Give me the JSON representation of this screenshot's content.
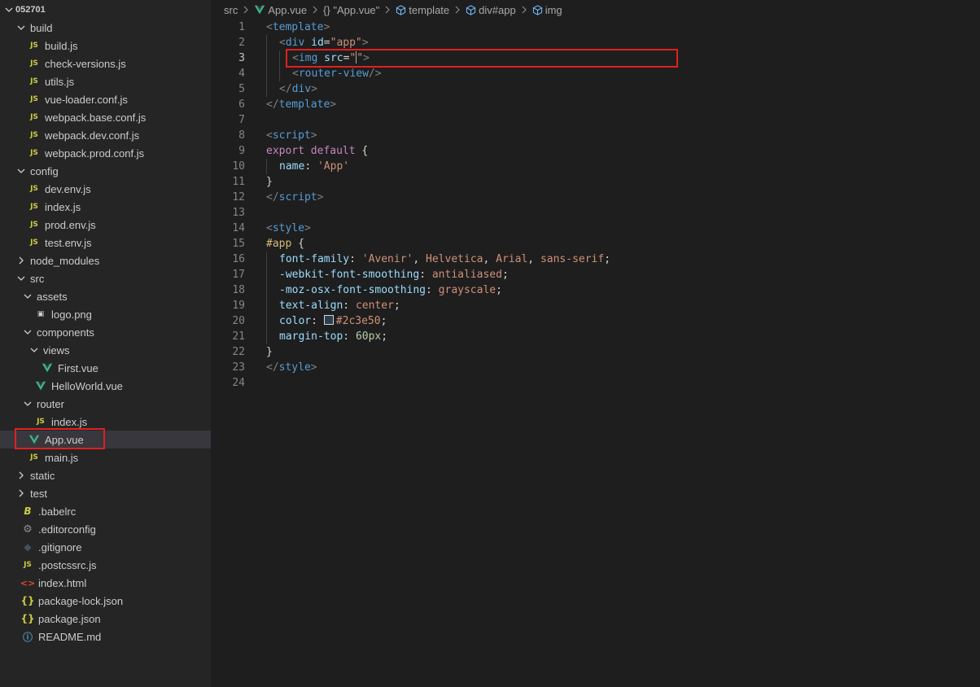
{
  "explorer": {
    "root": "052701",
    "items": [
      {
        "label": "build",
        "kind": "folder",
        "open": true,
        "depth": 1
      },
      {
        "label": "build.js",
        "kind": "js",
        "depth": 2
      },
      {
        "label": "check-versions.js",
        "kind": "js",
        "depth": 2
      },
      {
        "label": "utils.js",
        "kind": "js",
        "depth": 2
      },
      {
        "label": "vue-loader.conf.js",
        "kind": "js",
        "depth": 2
      },
      {
        "label": "webpack.base.conf.js",
        "kind": "js",
        "depth": 2
      },
      {
        "label": "webpack.dev.conf.js",
        "kind": "js",
        "depth": 2
      },
      {
        "label": "webpack.prod.conf.js",
        "kind": "js",
        "depth": 2
      },
      {
        "label": "config",
        "kind": "folder",
        "open": true,
        "depth": 1
      },
      {
        "label": "dev.env.js",
        "kind": "js",
        "depth": 2
      },
      {
        "label": "index.js",
        "kind": "js",
        "depth": 2
      },
      {
        "label": "prod.env.js",
        "kind": "js",
        "depth": 2
      },
      {
        "label": "test.env.js",
        "kind": "js",
        "depth": 2
      },
      {
        "label": "node_modules",
        "kind": "folder",
        "open": false,
        "depth": 1
      },
      {
        "label": "src",
        "kind": "folder",
        "open": true,
        "depth": 1
      },
      {
        "label": "assets",
        "kind": "folder",
        "open": true,
        "depth": 2
      },
      {
        "label": "logo.png",
        "kind": "png",
        "depth": 3
      },
      {
        "label": "components",
        "kind": "folder",
        "open": true,
        "depth": 2
      },
      {
        "label": "views",
        "kind": "folder",
        "open": true,
        "depth": 3
      },
      {
        "label": "First.vue",
        "kind": "vue",
        "depth": 4
      },
      {
        "label": "HelloWorld.vue",
        "kind": "vue",
        "depth": 3
      },
      {
        "label": "router",
        "kind": "folder",
        "open": true,
        "depth": 2
      },
      {
        "label": "index.js",
        "kind": "js",
        "depth": 3
      },
      {
        "label": "App.vue",
        "kind": "vue",
        "depth": 2,
        "selected": true
      },
      {
        "label": "main.js",
        "kind": "js",
        "depth": 2
      },
      {
        "label": "static",
        "kind": "folder",
        "open": false,
        "depth": 1
      },
      {
        "label": "test",
        "kind": "folder",
        "open": false,
        "depth": 1
      },
      {
        "label": ".babelrc",
        "kind": "babel",
        "depth": 1
      },
      {
        "label": ".editorconfig",
        "kind": "gear",
        "depth": 1
      },
      {
        "label": ".gitignore",
        "kind": "git",
        "depth": 1
      },
      {
        "label": ".postcssrc.js",
        "kind": "js",
        "depth": 1
      },
      {
        "label": "index.html",
        "kind": "html",
        "depth": 1
      },
      {
        "label": "package-lock.json",
        "kind": "json",
        "depth": 1
      },
      {
        "label": "package.json",
        "kind": "json",
        "depth": 1
      },
      {
        "label": "README.md",
        "kind": "info",
        "depth": 1
      }
    ]
  },
  "breadcrumb": [
    {
      "label": "src",
      "icon": ""
    },
    {
      "label": "App.vue",
      "icon": "vue-icon"
    },
    {
      "label": "{} \"App.vue\"",
      "icon": ""
    },
    {
      "label": "template",
      "icon": "cube-icon"
    },
    {
      "label": "div#app",
      "icon": "cube-icon"
    },
    {
      "label": "img",
      "icon": "cube-icon"
    }
  ],
  "editor": {
    "active_line": 3,
    "lines": [
      {
        "n": "1",
        "indent": 0,
        "tokens": [
          [
            "t-punc",
            "<"
          ],
          [
            "t-tag",
            "template"
          ],
          [
            "t-punc",
            ">"
          ]
        ]
      },
      {
        "n": "2",
        "indent": 1,
        "tokens": [
          [
            "t-punc",
            "<"
          ],
          [
            "t-tag",
            "div"
          ],
          [
            "t-txt",
            " "
          ],
          [
            "t-attr",
            "id"
          ],
          [
            "t-txt",
            "="
          ],
          [
            "t-str",
            "\"app\""
          ],
          [
            "t-punc",
            ">"
          ]
        ]
      },
      {
        "n": "3",
        "indent": 2,
        "tokens": [
          [
            "t-punc",
            "<"
          ],
          [
            "t-tag",
            "img"
          ],
          [
            "t-txt",
            " "
          ],
          [
            "t-attr",
            "src"
          ],
          [
            "t-txt",
            "="
          ],
          [
            "t-str",
            "\""
          ],
          [
            "cursor",
            ""
          ],
          [
            "t-str",
            "\""
          ],
          [
            "t-punc",
            ">"
          ]
        ]
      },
      {
        "n": "4",
        "indent": 2,
        "tokens": [
          [
            "t-punc",
            "<"
          ],
          [
            "t-tag",
            "router-view"
          ],
          [
            "t-punc",
            "/>"
          ]
        ]
      },
      {
        "n": "5",
        "indent": 1,
        "tokens": [
          [
            "t-punc",
            "</"
          ],
          [
            "t-tag",
            "div"
          ],
          [
            "t-punc",
            ">"
          ]
        ]
      },
      {
        "n": "6",
        "indent": 0,
        "tokens": [
          [
            "t-punc",
            "</"
          ],
          [
            "t-tag",
            "template"
          ],
          [
            "t-punc",
            ">"
          ]
        ]
      },
      {
        "n": "7",
        "indent": 0,
        "tokens": []
      },
      {
        "n": "8",
        "indent": 0,
        "tokens": [
          [
            "t-punc",
            "<"
          ],
          [
            "t-tag",
            "script"
          ],
          [
            "t-punc",
            ">"
          ]
        ]
      },
      {
        "n": "9",
        "indent": 0,
        "tokens": [
          [
            "t-kw",
            "export"
          ],
          [
            "t-txt",
            " "
          ],
          [
            "t-kw",
            "default"
          ],
          [
            "t-txt",
            " {"
          ]
        ]
      },
      {
        "n": "10",
        "indent": 1,
        "tokens": [
          [
            "t-attr",
            "name"
          ],
          [
            "t-txt",
            ": "
          ],
          [
            "t-str",
            "'App'"
          ]
        ]
      },
      {
        "n": "11",
        "indent": 0,
        "tokens": [
          [
            "t-txt",
            "}"
          ]
        ]
      },
      {
        "n": "12",
        "indent": 0,
        "tokens": [
          [
            "t-punc",
            "</"
          ],
          [
            "t-tag",
            "script"
          ],
          [
            "t-punc",
            ">"
          ]
        ]
      },
      {
        "n": "13",
        "indent": 0,
        "tokens": []
      },
      {
        "n": "14",
        "indent": 0,
        "tokens": [
          [
            "t-punc",
            "<"
          ],
          [
            "t-tag",
            "style"
          ],
          [
            "t-punc",
            ">"
          ]
        ]
      },
      {
        "n": "15",
        "indent": 0,
        "tokens": [
          [
            "t-sel",
            "#app"
          ],
          [
            "t-txt",
            " {"
          ]
        ]
      },
      {
        "n": "16",
        "indent": 1,
        "tokens": [
          [
            "t-attr",
            "font-family"
          ],
          [
            "t-txt",
            ": "
          ],
          [
            "t-str",
            "'Avenir'"
          ],
          [
            "t-txt",
            ", "
          ],
          [
            "t-str",
            "Helvetica"
          ],
          [
            "t-txt",
            ", "
          ],
          [
            "t-str",
            "Arial"
          ],
          [
            "t-txt",
            ", "
          ],
          [
            "t-str",
            "sans-serif"
          ],
          [
            "t-txt",
            ";"
          ]
        ]
      },
      {
        "n": "17",
        "indent": 1,
        "tokens": [
          [
            "t-attr",
            "-webkit-font-smoothing"
          ],
          [
            "t-txt",
            ": "
          ],
          [
            "t-str",
            "antialiased"
          ],
          [
            "t-txt",
            ";"
          ]
        ]
      },
      {
        "n": "18",
        "indent": 1,
        "tokens": [
          [
            "t-attr",
            "-moz-osx-font-smoothing"
          ],
          [
            "t-txt",
            ": "
          ],
          [
            "t-str",
            "grayscale"
          ],
          [
            "t-txt",
            ";"
          ]
        ]
      },
      {
        "n": "19",
        "indent": 1,
        "tokens": [
          [
            "t-attr",
            "text-align"
          ],
          [
            "t-txt",
            ": "
          ],
          [
            "t-str",
            "center"
          ],
          [
            "t-txt",
            ";"
          ]
        ]
      },
      {
        "n": "20",
        "indent": 1,
        "tokens": [
          [
            "t-attr",
            "color"
          ],
          [
            "t-txt",
            ": "
          ],
          [
            "swatch",
            ""
          ],
          [
            "t-str",
            "#2c3e50"
          ],
          [
            "t-txt",
            ";"
          ]
        ]
      },
      {
        "n": "21",
        "indent": 1,
        "tokens": [
          [
            "t-attr",
            "margin-top"
          ],
          [
            "t-txt",
            ": "
          ],
          [
            "t-num",
            "60px"
          ],
          [
            "t-txt",
            ";"
          ]
        ]
      },
      {
        "n": "22",
        "indent": 0,
        "tokens": [
          [
            "t-txt",
            "}"
          ]
        ]
      },
      {
        "n": "23",
        "indent": 0,
        "tokens": [
          [
            "t-punc",
            "</"
          ],
          [
            "t-tag",
            "style"
          ],
          [
            "t-punc",
            ">"
          ]
        ]
      },
      {
        "n": "24",
        "indent": 0,
        "tokens": []
      }
    ]
  },
  "colors": {
    "highlight_box": "#e02020",
    "swatch": "#2c3e50"
  }
}
